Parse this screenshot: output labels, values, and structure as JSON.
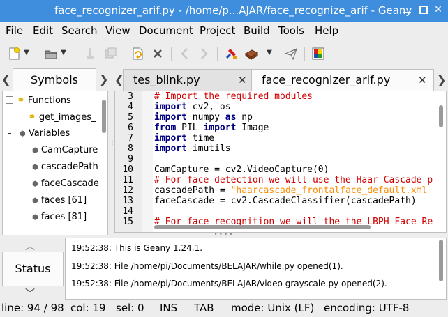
{
  "window": {
    "title": "face_recognizer_arif.py - /home/p...AJAR/face_recognize_arif - Geany"
  },
  "menu": [
    "File",
    "Edit",
    "Search",
    "View",
    "Document",
    "Project",
    "Build",
    "Tools",
    "Help"
  ],
  "toolbar": {
    "icons": [
      "new-file-icon",
      "open-file-icon",
      "save-icon",
      "save-all-icon",
      "reload-icon",
      "close-file-icon",
      "back-icon",
      "forward-icon",
      "compile-icon",
      "build-icon",
      "run-icon",
      "color-chooser-icon"
    ]
  },
  "sidebar": {
    "tab_label": "Symbols",
    "tree": {
      "functions_label": "Functions",
      "functions": [
        "get_images_"
      ],
      "variables_label": "Variables",
      "variables": [
        "CamCapture",
        "cascadePath",
        "faceCascade",
        "faces [61]",
        "faces [81]"
      ]
    }
  },
  "editor": {
    "tabs": [
      "tes_blink.py",
      "face_recognizer_arif.py"
    ],
    "active_tab": "face_recognizer_arif.py",
    "line_numbers": [
      "3",
      "4",
      "5",
      "6",
      "7",
      "8",
      "9",
      "10",
      "11",
      "12",
      "13",
      "14",
      "15"
    ],
    "lines": [
      "# Import the required modules",
      "import cv2, os",
      "import numpy as np",
      "from PIL import Image",
      "import time",
      "import imutils",
      "",
      "CamCapture = cv2.VideoCapture(0)",
      "# For face detection we will use the Haar Cascade p",
      "cascadePath = \"haarcascade_frontalface_default.xml",
      "faceCascade = cv2.CascadeClassifier(cascadePath)",
      "",
      "# For face recognition we will the the LBPH Face Re"
    ]
  },
  "messages": {
    "tab_label": "Status",
    "lines": [
      "19:52:38: This is Geany 1.24.1.",
      "19:52:38: File /home/pi/Documents/BELAJAR/while.py opened(1).",
      "19:52:38: File /home/pi/Documents/BELAJAR/video grayscale.py opened(2)."
    ]
  },
  "statusbar": {
    "line": "line: 94 / 98",
    "col": "col: 19",
    "sel": "sel: 0",
    "ins": "INS",
    "tab": "TAB",
    "mode": "mode: Unix (LF)",
    "encoding": "encoding: UTF-8"
  },
  "colors": {
    "titlebar": "#3f8ede",
    "keyword": "#00007f",
    "comment": "#d00000",
    "string": "#ff8c00"
  }
}
